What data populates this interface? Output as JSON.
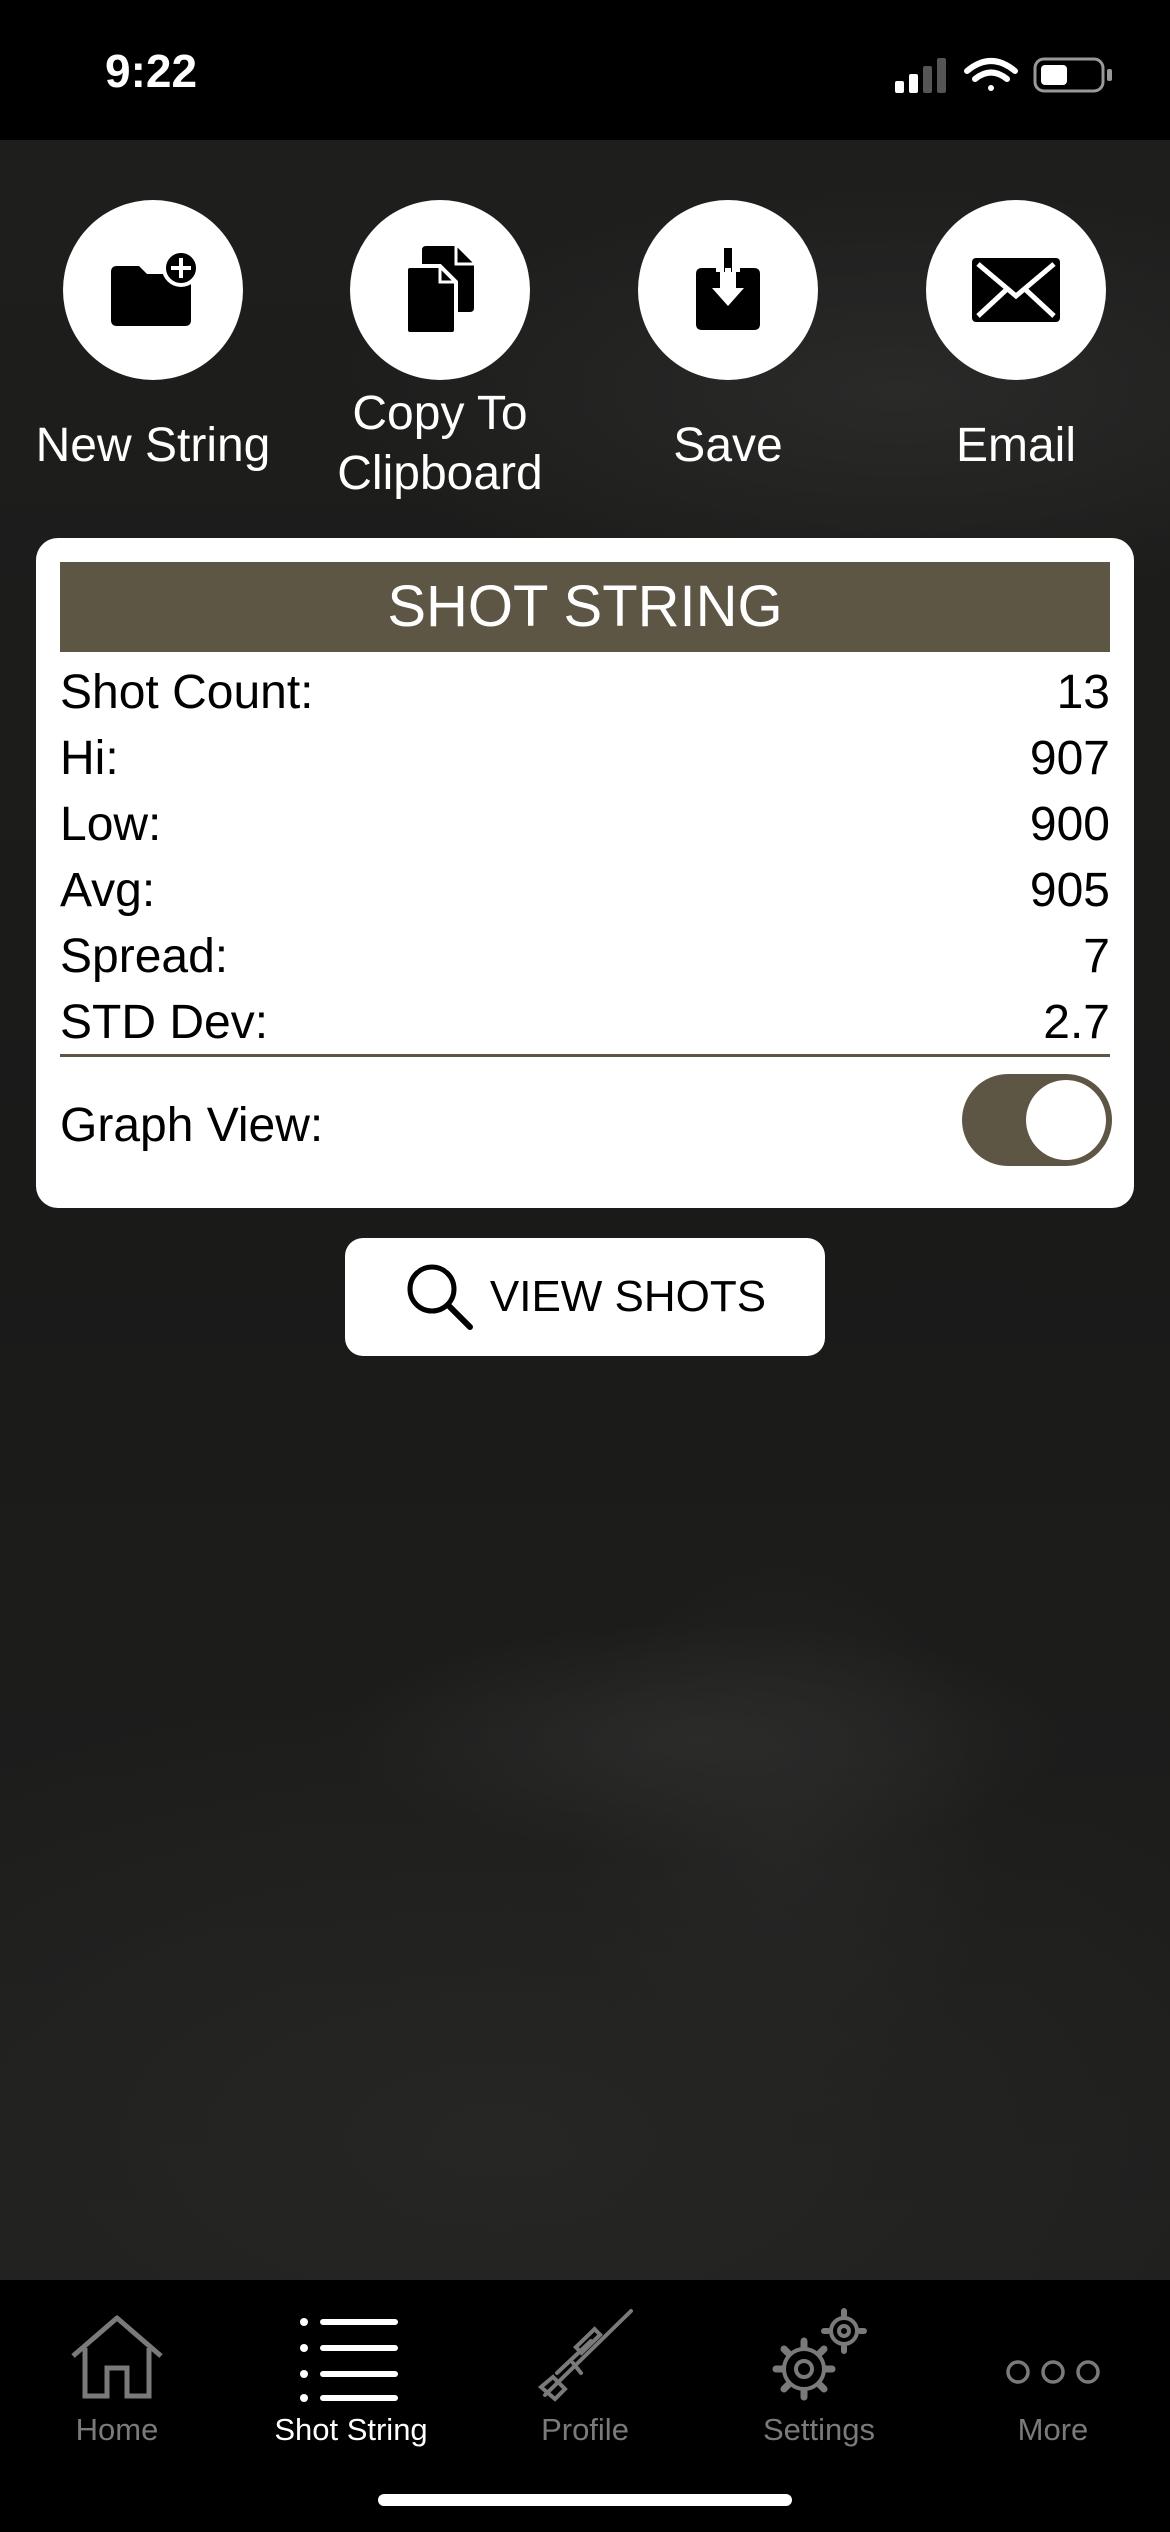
{
  "status_bar": {
    "time": "9:22"
  },
  "actions": [
    {
      "label": "New String",
      "icon": "new-folder-icon"
    },
    {
      "label": "Copy To Clipboard",
      "icon": "copy-icon"
    },
    {
      "label": "Save",
      "icon": "save-download-icon"
    },
    {
      "label": "Email",
      "icon": "envelope-icon"
    }
  ],
  "card": {
    "title": "SHOT STRING",
    "rows": [
      {
        "label": "Shot Count:",
        "value": "13"
      },
      {
        "label": "Hi:",
        "value": "907"
      },
      {
        "label": "Low:",
        "value": "900"
      },
      {
        "label": "Avg:",
        "value": "905"
      },
      {
        "label": "Spread:",
        "value": "7"
      },
      {
        "label": "STD Dev:",
        "value": "2.7"
      }
    ],
    "graph_view_label": "Graph View:",
    "graph_view_on": true
  },
  "view_shots_button": "VIEW SHOTS",
  "tabs": [
    {
      "label": "Home",
      "icon": "home-icon",
      "active": false
    },
    {
      "label": "Shot String",
      "icon": "list-icon",
      "active": true
    },
    {
      "label": "Profile",
      "icon": "rifle-icon",
      "active": false
    },
    {
      "label": "Settings",
      "icon": "gears-icon",
      "active": false
    },
    {
      "label": "More",
      "icon": "more-dots-icon",
      "active": false
    }
  ],
  "colors": {
    "accent": "#5e5644",
    "tab_inactive": "#7a7a7a"
  }
}
